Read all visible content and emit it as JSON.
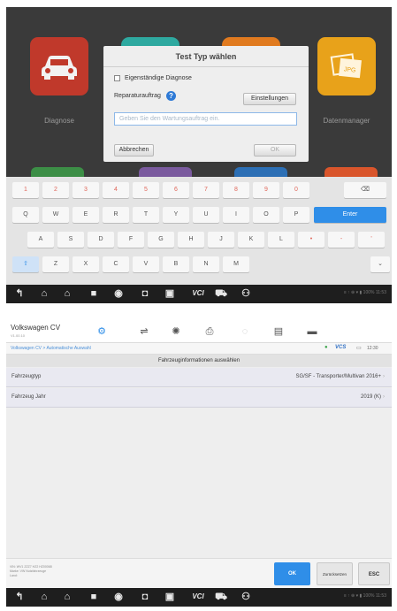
{
  "top_screen": {
    "tiles": [
      {
        "label": "Diagnose",
        "color": "#c0392b",
        "icon": "car-icon"
      },
      {
        "label": "",
        "color": "#2ea9a0",
        "icon": "tile-icon"
      },
      {
        "label": "",
        "color": "#e07a1f",
        "icon": "tile-icon"
      },
      {
        "label": "Datenmanager",
        "color": "#e8a21a",
        "icon": "folder-icon"
      }
    ],
    "dialog": {
      "title": "Test Typ wählen",
      "checkbox_label": "Eigenständige Diagnose",
      "repair_label": "Reparaturauftrag",
      "settings_button": "Einstellungen",
      "input_placeholder": "Geben Sie den Wartungsauftrag ein.",
      "cancel_button": "Abbrechen",
      "ok_button": "OK"
    },
    "keyboard": {
      "row1": [
        "1",
        "2",
        "3",
        "4",
        "5",
        "6",
        "7",
        "8",
        "9",
        "0",
        "⌫"
      ],
      "row2": [
        "Q",
        "W",
        "E",
        "R",
        "T",
        "Y",
        "U",
        "I",
        "O",
        "P"
      ],
      "enter": "Enter",
      "row3": [
        "A",
        "S",
        "D",
        "F",
        "G",
        "H",
        "J",
        "K",
        "L",
        "•",
        "-",
        "'"
      ],
      "row4": [
        "⇧",
        "Z",
        "X",
        "C",
        "V",
        "B",
        "N",
        "M"
      ],
      "hide_key": "⌄"
    }
  },
  "bottom_screen": {
    "app_title": "Volkswagen CV",
    "app_subtitle": "V1.00.10",
    "breadcrumb": "Volkswagen CV > Automatische Auswahl",
    "vci_label": "VCS",
    "clock": "12:30",
    "section_title": "Fahrzeuginformationen auswählen",
    "rows": [
      {
        "label": "Fahrzeugtyp",
        "value": "SG/SF - Transporter/Multivan 2016+"
      },
      {
        "label": "Fahrzeug Jahr",
        "value": "2019 (K)"
      }
    ],
    "footer_info": [
      "VIN: WV1 ZZZ7 HZ2 HZ00068",
      "Marke: VW Nutzfahrzeuge",
      "Land:"
    ],
    "ok_button": "OK",
    "back_button": "Zurücksetzen",
    "esc_button": "ESC"
  },
  "navbar": {
    "vci_label": "VCI",
    "status_text": "≡ ↑ ⊕ ▾ ▮ 100% 11:53"
  }
}
